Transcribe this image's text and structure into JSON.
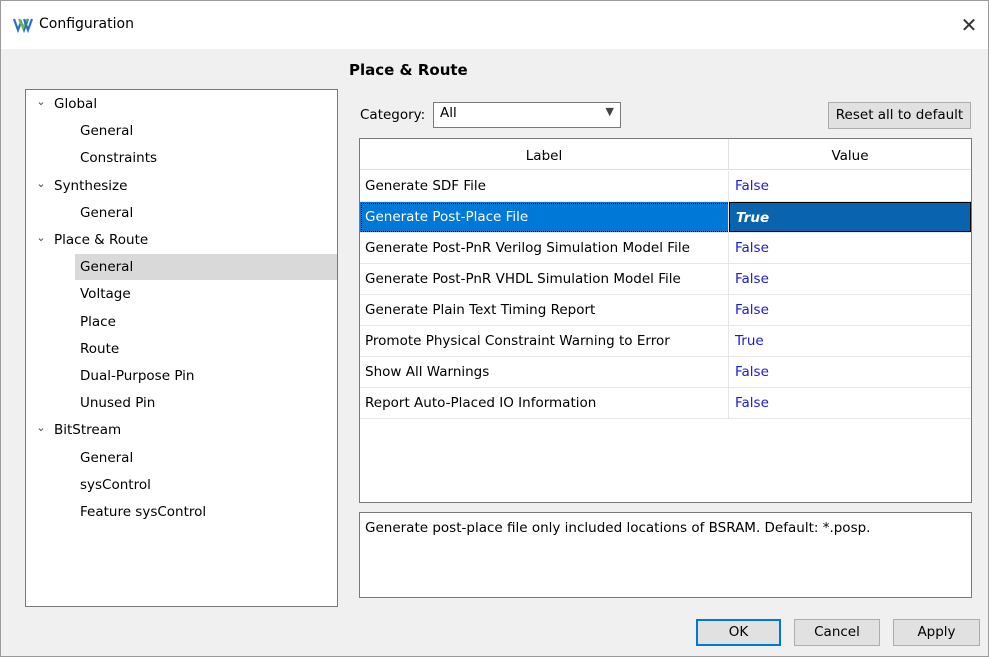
{
  "window": {
    "title": "Configuration"
  },
  "page": {
    "title": "Place & Route"
  },
  "tree": {
    "items": [
      {
        "label": "Global",
        "level": 0
      },
      {
        "label": "General",
        "level": 1
      },
      {
        "label": "Constraints",
        "level": 1
      },
      {
        "label": "Synthesize",
        "level": 0
      },
      {
        "label": "General",
        "level": 1
      },
      {
        "label": "Place & Route",
        "level": 0
      },
      {
        "label": "General",
        "level": 1,
        "selected": true
      },
      {
        "label": "Voltage",
        "level": 1
      },
      {
        "label": "Place",
        "level": 1
      },
      {
        "label": "Route",
        "level": 1
      },
      {
        "label": "Dual-Purpose Pin",
        "level": 1
      },
      {
        "label": "Unused Pin",
        "level": 1
      },
      {
        "label": "BitStream",
        "level": 0
      },
      {
        "label": "General",
        "level": 1
      },
      {
        "label": "sysControl",
        "level": 1
      },
      {
        "label": "Feature sysControl",
        "level": 1
      }
    ]
  },
  "filter": {
    "category_label": "Category:",
    "category_value": "All",
    "reset_label": "Reset all to default"
  },
  "grid": {
    "columns": [
      "Label",
      "Value"
    ],
    "rows": [
      {
        "label": "Generate SDF File",
        "value": "False"
      },
      {
        "label": "Generate Post-Place File",
        "value": "True",
        "selected": true
      },
      {
        "label": "Generate Post-PnR Verilog Simulation Model File",
        "value": "False"
      },
      {
        "label": "Generate Post-PnR VHDL Simulation Model File",
        "value": "False"
      },
      {
        "label": "Generate Plain Text Timing Report",
        "value": "False"
      },
      {
        "label": "Promote Physical Constraint Warning to Error",
        "value": "True"
      },
      {
        "label": "Show All Warnings",
        "value": "False"
      },
      {
        "label": "Report Auto-Placed IO Information",
        "value": "False"
      }
    ]
  },
  "description": "Generate post-place file only included locations of BSRAM. Default: *.posp.",
  "buttons": {
    "ok": "OK",
    "cancel": "Cancel",
    "apply": "Apply"
  },
  "colors": {
    "selection": "#0078d7",
    "value_text": "#1a1ad6"
  }
}
